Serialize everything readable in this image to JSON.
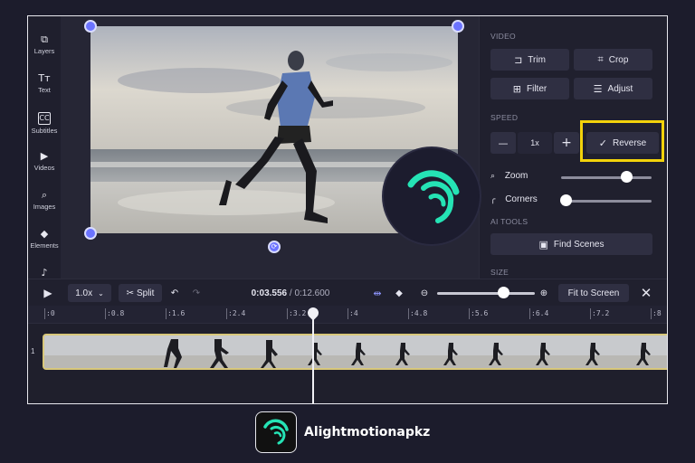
{
  "sidebar": {
    "items": [
      {
        "label": "Layers",
        "icon": "⧉"
      },
      {
        "label": "Text",
        "icon": "Tт"
      },
      {
        "label": "Subtitles",
        "icon": "CC"
      },
      {
        "label": "Videos",
        "icon": "▶"
      },
      {
        "label": "Images",
        "icon": "⌕"
      },
      {
        "label": "Elements",
        "icon": "◆"
      },
      {
        "label": "",
        "icon": "♪"
      }
    ]
  },
  "panel": {
    "video_title": "VIDEO",
    "trim_label": "Trim",
    "crop_label": "Crop",
    "filter_label": "Filter",
    "adjust_label": "Adjust",
    "speed_title": "SPEED",
    "speed_value": "1x",
    "minus_label": "—",
    "plus_label": "+",
    "reverse_label": "Reverse",
    "reverse_check": "✓",
    "zoom_label": "Zoom",
    "corners_label": "Corners",
    "zoom_level": 0.72,
    "corners_level": 0.05,
    "ai_tools_title": "AI TOOLS",
    "find_scenes_label": "Find Scenes",
    "size_title": "SIZE"
  },
  "toolbar": {
    "play_icon": "▶",
    "speed_select": "1.0x",
    "split_label": "Split",
    "current_time": "0:03.556",
    "separator": " / ",
    "total_time": "0:12.600",
    "fit_label": "Fit to Screen",
    "close_icon": "✕",
    "timeline_zoom_level": 0.68
  },
  "ruler": {
    "ticks": [
      ":0",
      ":0.8",
      ":1.6",
      ":2.4",
      ":3.2",
      ":4",
      ":4.8",
      ":5.6",
      ":6.4",
      ":7.2",
      ":8"
    ]
  },
  "track": {
    "number": "1"
  },
  "brand": {
    "name": "Alightmotionapkz"
  },
  "colors": {
    "accent": "#6b73ff",
    "highlight": "#f2d20b",
    "logo_teal": "#25e3b5"
  }
}
